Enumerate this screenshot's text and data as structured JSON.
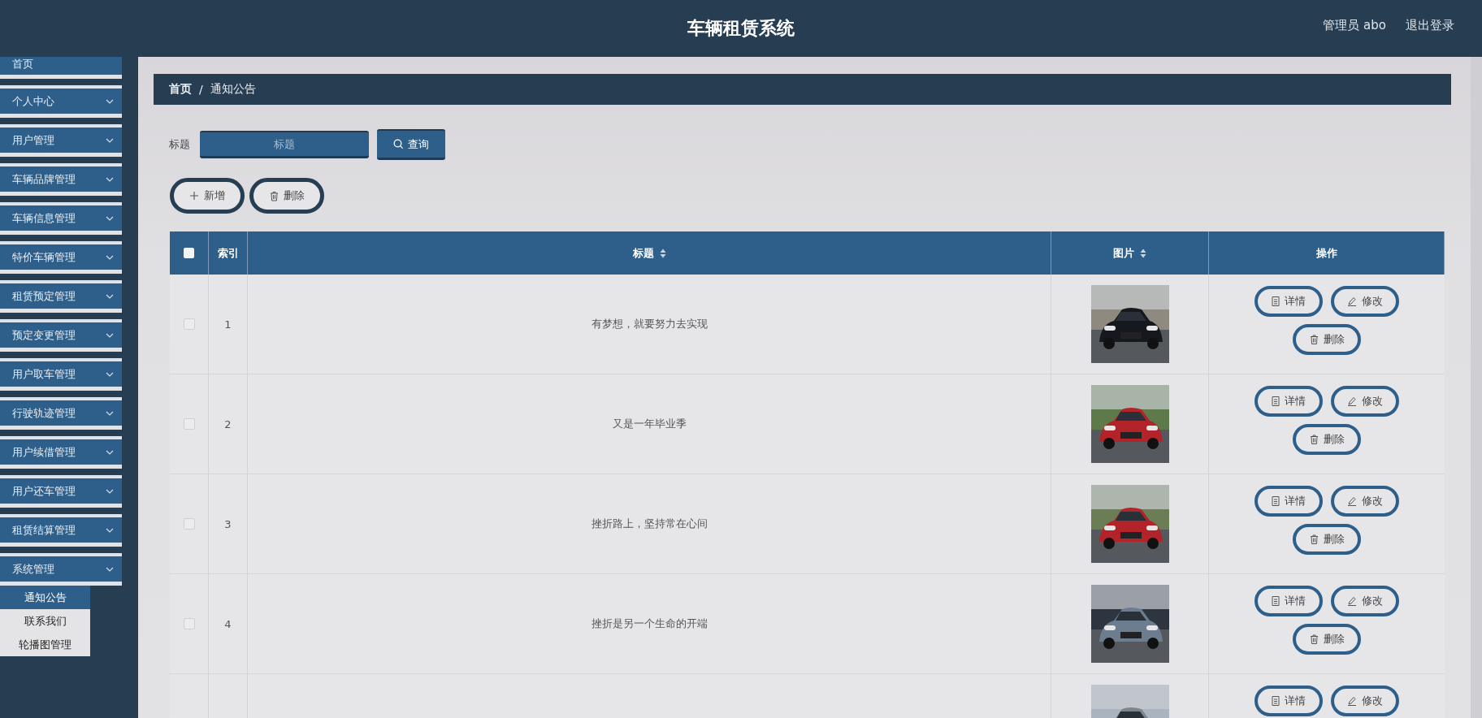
{
  "header": {
    "title": "车辆租赁系统",
    "user": "管理员 abo",
    "logout": "退出登录"
  },
  "sidebar": {
    "items": [
      {
        "label": "首页",
        "kind": "link"
      },
      {
        "label": "个人中心",
        "kind": "group"
      },
      {
        "label": "用户管理",
        "kind": "group"
      },
      {
        "label": "车辆品牌管理",
        "kind": "group"
      },
      {
        "label": "车辆信息管理",
        "kind": "group"
      },
      {
        "label": "特价车辆管理",
        "kind": "group"
      },
      {
        "label": "租赁预定管理",
        "kind": "group"
      },
      {
        "label": "预定变更管理",
        "kind": "group"
      },
      {
        "label": "用户取车管理",
        "kind": "group"
      },
      {
        "label": "行驶轨迹管理",
        "kind": "group"
      },
      {
        "label": "用户续借管理",
        "kind": "group"
      },
      {
        "label": "用户还车管理",
        "kind": "group"
      },
      {
        "label": "租赁结算管理",
        "kind": "group"
      },
      {
        "label": "系统管理",
        "kind": "group",
        "children": [
          {
            "label": "通知公告",
            "selected": true
          },
          {
            "label": "联系我们",
            "selected": false
          },
          {
            "label": "轮播图管理",
            "selected": false
          }
        ]
      }
    ]
  },
  "breadcrumb": {
    "separator": "/",
    "items": [
      "首页",
      "通知公告"
    ]
  },
  "search": {
    "label": "标题",
    "placeholder": "标题",
    "button": "查询"
  },
  "actions": [
    "新增",
    "删除"
  ],
  "table": {
    "select_all": {
      "checked": false
    },
    "columns": [
      {
        "label": "索引",
        "sortable": false
      },
      {
        "label": "标题",
        "sortable": true
      },
      {
        "label": "图片",
        "sortable": true
      },
      {
        "label": "操作",
        "sortable": false
      }
    ],
    "rows": [
      {
        "checked": false,
        "index": "1",
        "title": "有梦想，就要努力去实现",
        "image": {
          "kind": "picture"
        },
        "buttons": [
          "详情",
          "修改",
          "删除"
        ]
      },
      {
        "checked": false,
        "index": "2",
        "title": "又是一年毕业季",
        "image": {
          "kind": "picture"
        },
        "buttons": [
          "详情",
          "修改",
          "删除"
        ]
      },
      {
        "checked": false,
        "index": "3",
        "title": "挫折路上，坚持常在心间",
        "image": {
          "kind": "picture"
        },
        "buttons": [
          "详情",
          "修改",
          "删除"
        ]
      },
      {
        "checked": false,
        "index": "4",
        "title": "挫折是另一个生命的开端",
        "image": {
          "kind": "picture"
        },
        "buttons": [
          "详情",
          "修改",
          "删除"
        ]
      },
      {
        "image": {
          "kind": "picture"
        },
        "buttons": [
          "详情",
          "修改"
        ]
      }
    ]
  }
}
